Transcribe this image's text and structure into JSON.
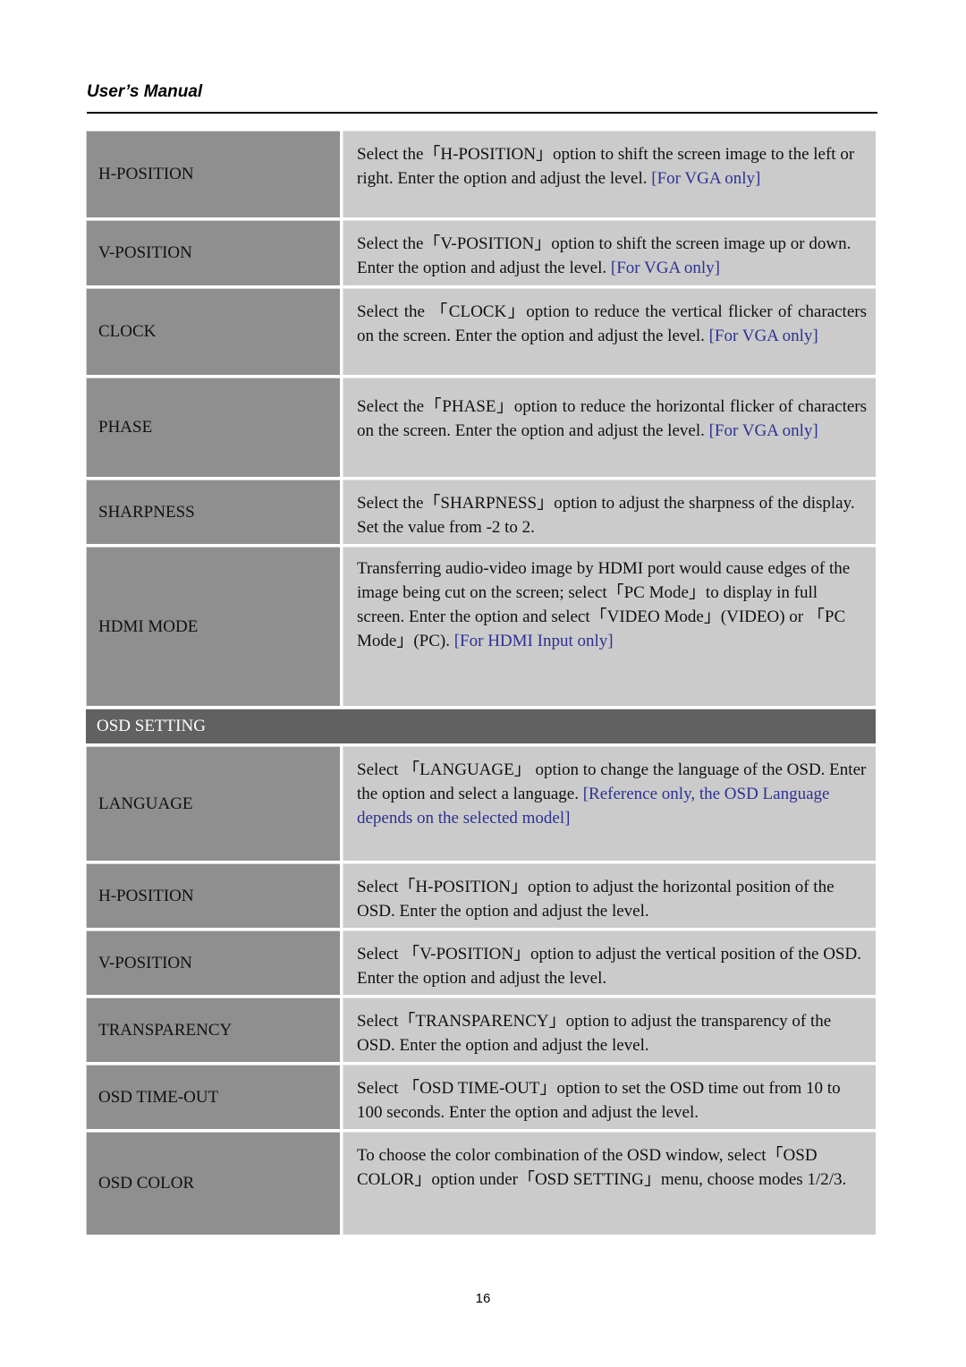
{
  "header": {
    "title": "User’s Manual"
  },
  "colors": {
    "note": "#2e3192",
    "label_bg": "#8f8f8f",
    "desc_bg": "#cbcbcb",
    "section_bg": "#616161"
  },
  "rows_top": [
    {
      "label": "H-POSITION",
      "text": "Select the「H-POSITION」option to shift the screen image to the left or right. Enter the option and adjust the level. ",
      "note": "[For VGA only]"
    },
    {
      "label": "V-POSITION",
      "text": "Select the「V-POSITION」option to shift the screen image up or down. Enter the option and adjust the level. ",
      "note": "[For VGA only]"
    },
    {
      "label": "CLOCK",
      "text": "Select the 「CLOCK」option to reduce the vertical flicker of characters on the screen. Enter the option and adjust the level. ",
      "note": "[For VGA only]"
    },
    {
      "label": "PHASE",
      "text": "Select the「PHASE」option to reduce the horizontal flicker of characters on the screen. Enter the option and adjust the level. ",
      "note": "[For VGA only]"
    },
    {
      "label": "SHARPNESS",
      "text": "Select the「SHARPNESS」option to adjust the sharpness of the display. Set the value from -2 to 2.",
      "note": ""
    },
    {
      "label": "HDMI MODE",
      "text": "Transferring audio-video image by HDMI port would cause edges of the image being cut on the screen; select「PC Mode」to display in full screen. Enter the option and select「VIDEO Mode」(VIDEO) or 「PC Mode」(PC). ",
      "note": "[For HDMI Input only]"
    }
  ],
  "section": {
    "title": "OSD SETTING"
  },
  "rows_osd": [
    {
      "label": "LANGUAGE",
      "text": "Select 「LANGUAGE」 option to change the language of the OSD. Enter the option and select a language. ",
      "note": "[Reference only, the OSD Language depends on the selected model]"
    },
    {
      "label": "H-POSITION",
      "text": "Select「H-POSITION」option to adjust the horizontal position of the OSD. Enter the option and adjust the level.",
      "note": ""
    },
    {
      "label": "V-POSITION",
      "text": "Select 「V-POSITION」option to adjust the vertical position of the OSD. Enter the option and adjust the level.",
      "note": ""
    },
    {
      "label": "TRANSPARENCY",
      "text": "Select「TRANSPARENCY」option to adjust the transparency of the OSD. Enter the option and adjust the level.",
      "note": ""
    },
    {
      "label": "OSD TIME-OUT",
      "text": "Select 「OSD TIME-OUT」option to set the OSD time out from 10 to 100 seconds. Enter the option and adjust the level.",
      "note": ""
    },
    {
      "label": "OSD COLOR",
      "text": "To choose the color combination of the OSD window, select「OSD COLOR」option under「OSD SETTING」menu, choose modes 1/2/3.",
      "note": ""
    }
  ],
  "footer": {
    "page_number": "16"
  }
}
